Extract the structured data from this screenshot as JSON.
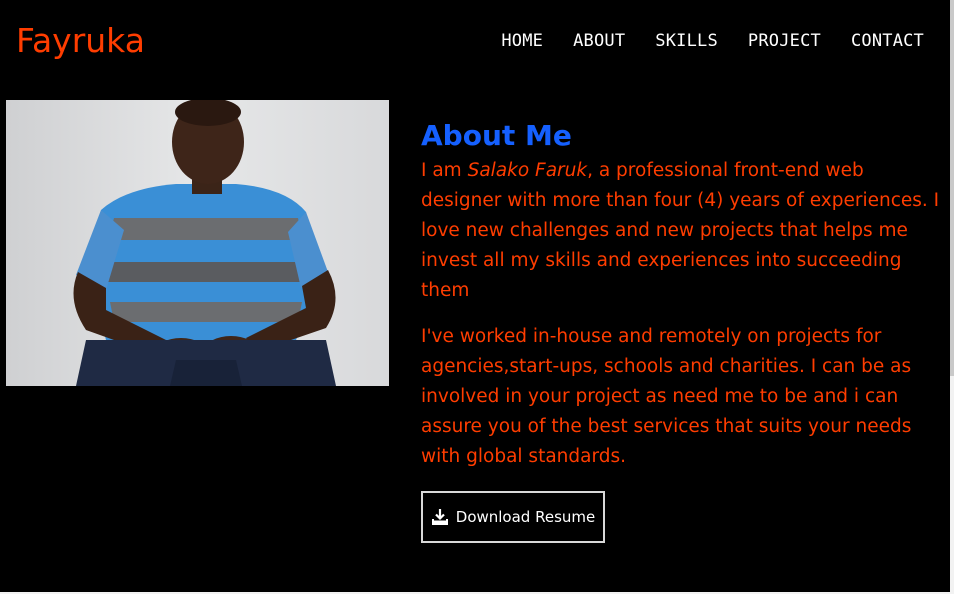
{
  "header": {
    "brand": "Fayruka",
    "nav": [
      {
        "label": "HOME"
      },
      {
        "label": "ABOUT"
      },
      {
        "label": "SKILLS"
      },
      {
        "label": "PROJECT"
      },
      {
        "label": "CONTACT"
      }
    ]
  },
  "about": {
    "title": "About Me",
    "para1_prefix": "I am ",
    "para1_name": "Salako Faruk",
    "para1_suffix": ", a professional front-end web designer with more than four (4) years of experiences. I love new challenges and new projects that helps me invest all my skills and experiences into succeeding them",
    "para2": "I've worked in-house and remotely on projects for agencies,start-ups, schools and charities. I can be as involved in your project as need me to be and i can assure you of the best services that suits your needs with global standards.",
    "resume_button": "Download Resume",
    "resume_icon": "download-icon"
  },
  "colors": {
    "accent": "#ff3d00",
    "title": "#1560ff",
    "background": "#000000",
    "nav_text": "#ffffff"
  }
}
